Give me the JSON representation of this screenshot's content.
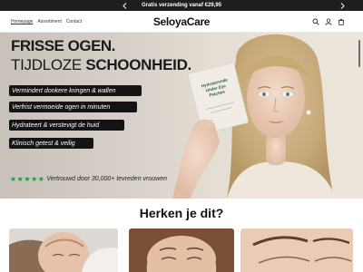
{
  "announcement": {
    "text": "Gratis verzending vanaf €29,95",
    "prev_icon": "chevron-left-icon",
    "next_icon": "chevron-right-icon"
  },
  "header": {
    "nav": [
      "Homepage",
      "Assortiment",
      "Contact"
    ],
    "logo": "SeloyaCare",
    "icons": [
      "search-icon",
      "account-icon",
      "cart-icon"
    ]
  },
  "hero": {
    "headline_line1": "FRISSE OGEN.",
    "headline_line2_regular": "TIJDLOZE ",
    "headline_line2_bold": "SCHOONHEID.",
    "benefits": [
      "Vermindert donkere kringen & wallen",
      "Verfrist vermoeide ogen in minuten",
      "Hydrateert & verstevigt de huid",
      "Klinisch getest & veilig"
    ],
    "trust_stars": "★★★★★",
    "trust_text": "Vertrouwd door 30,000+ tevreden vrouwen",
    "packet_text": [
      "Hydraterende",
      "Under Eye",
      "Patches"
    ],
    "colors": {
      "pill_bg": "#141414",
      "stars": "#1f9a44"
    }
  },
  "section": {
    "title": "Herken je dit?"
  }
}
